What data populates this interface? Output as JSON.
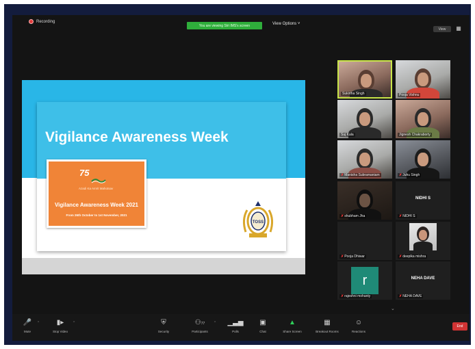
{
  "topbar": {
    "recording_label": "Recording",
    "share_banner": "You are viewing Stri IMS's screen",
    "view_options": "View Options ˅",
    "view_button": "View",
    "grid_icon": "grid-view-icon"
  },
  "slide": {
    "title": "Vigilance Awareness Week",
    "logo_number": "75",
    "logo_text": "Azadi Ka Amrit Mahotsav",
    "orange_title": "Vigilance Awareness Week 2021",
    "orange_dates": "From 26th October to 1st November, 2021",
    "emblem_text": "TOSS",
    "colors": {
      "band": "#29b6e7",
      "orange": "#f08437"
    }
  },
  "participants": [
    {
      "name": "Sukirtha Singh",
      "muted": false,
      "video": true
    },
    {
      "name": "Pooja Vishnu",
      "muted": false,
      "video": true
    },
    {
      "name": "Suj Kala",
      "muted": false,
      "video": true
    },
    {
      "name": "Jignesh Chakraborty",
      "muted": false,
      "video": true
    },
    {
      "name": "Manisha Subramaniam",
      "muted": true,
      "video": true
    },
    {
      "name": "Juhu Singh",
      "muted": true,
      "video": true
    },
    {
      "name": "shubham Jha",
      "muted": true,
      "video": true
    },
    {
      "name": "NIDHI S",
      "muted": true,
      "video": false
    },
    {
      "name": "Pooja Dhiwar",
      "muted": true,
      "video": false
    },
    {
      "name": "deepika mishra",
      "muted": true,
      "video": true
    },
    {
      "name": "rajeshni mohanty",
      "muted": true,
      "video": false,
      "initial": "r"
    },
    {
      "name": "NEHA DAVE",
      "muted": true,
      "video": false
    }
  ],
  "toolbar": {
    "mute": "Mute",
    "stop_video": "Stop Video",
    "security": "Security",
    "participants": "Participants",
    "participants_count": "77",
    "polls": "Polls",
    "chat": "Chat",
    "share_screen": "Share Screen",
    "breakout_rooms": "Breakout Rooms",
    "reactions": "Reactions",
    "end": "End"
  }
}
